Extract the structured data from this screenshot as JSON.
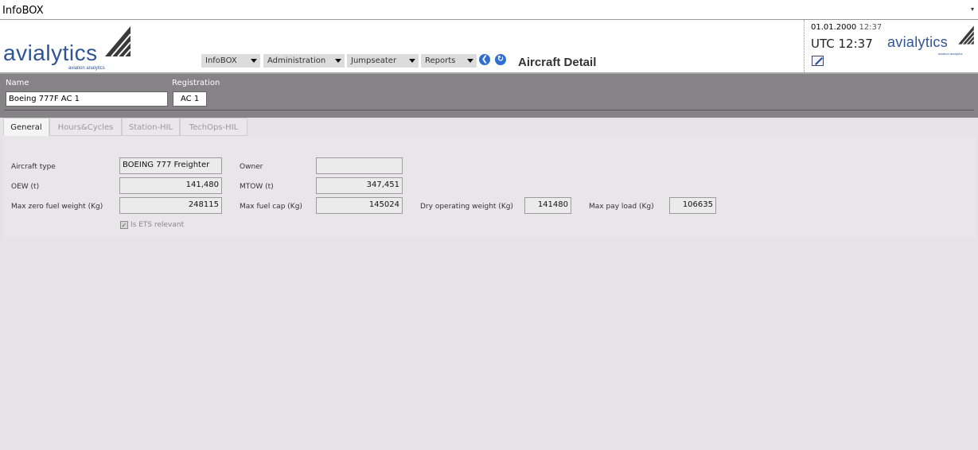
{
  "window": {
    "title": "InfoBOX",
    "menu_caret": "▾"
  },
  "brand": {
    "name": "avialytics",
    "tagline": "aviation analytics",
    "color": "#2f5597"
  },
  "menus": [
    {
      "label": "InfoBOX"
    },
    {
      "label": "Administration"
    },
    {
      "label": "Jumpseater"
    },
    {
      "label": "Reports"
    }
  ],
  "nav_buttons": {
    "back": {
      "icon": "back-arrow-icon",
      "glyph": "❮"
    },
    "refresh": {
      "icon": "refresh-icon",
      "glyph": "↻"
    }
  },
  "page_title": "Aircraft Detail",
  "clock": {
    "date": "01.01.2000",
    "time": "12:37",
    "utc": "UTC 12:37"
  },
  "aircraft": {
    "name_label": "Name",
    "name_value": "Boeing 777F AC 1",
    "registration_label": "Registration",
    "registration_value": "AC 1"
  },
  "tabs": [
    {
      "label": "General",
      "active": true
    },
    {
      "label": "Hours&Cycles",
      "active": false
    },
    {
      "label": "Station-HIL",
      "active": false
    },
    {
      "label": "TechOps-HIL",
      "active": false
    }
  ],
  "general": {
    "aircraft_type": {
      "label": "Aircraft type",
      "value": "BOEING 777 Freighter"
    },
    "owner": {
      "label": "Owner",
      "value": ""
    },
    "oew": {
      "label": "OEW (t)",
      "value": "141,480"
    },
    "mtow": {
      "label": "MTOW (t)",
      "value": "347,451"
    },
    "mzfw": {
      "label": "Max zero fuel weight (Kg)",
      "value": "248115"
    },
    "max_fuel_cap": {
      "label": "Max fuel cap (Kg)",
      "value": "145024"
    },
    "dry_operating_weight": {
      "label": "Dry operating weight (Kg)",
      "value": "141480"
    },
    "max_pay_load": {
      "label": "Max pay load (Kg)",
      "value": "106635"
    },
    "ets_relevant": {
      "label": "Is ETS relevant",
      "checked": true,
      "mark": "✓"
    }
  }
}
